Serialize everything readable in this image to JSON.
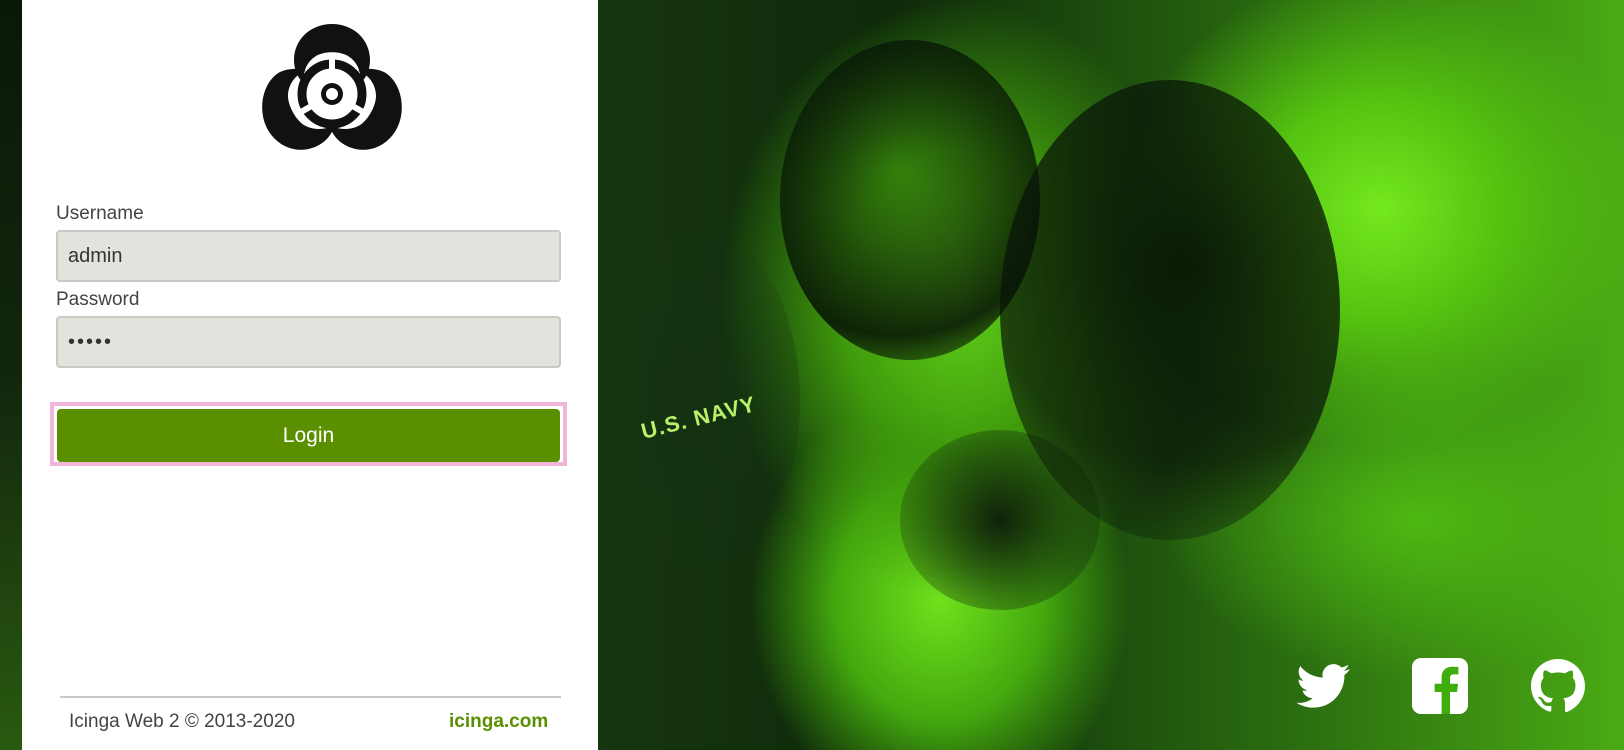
{
  "login_form": {
    "username_label": "Username",
    "username_value": "admin",
    "password_label": "Password",
    "password_value": "•••••",
    "login_button_label": "Login"
  },
  "footer": {
    "copyright": "Icinga Web 2 © 2013-2020",
    "link_text": "icinga.com"
  },
  "background": {
    "caption_text": "U.S. NAVY"
  },
  "icons": {
    "logo": "biohazard-icon",
    "social": [
      "twitter-icon",
      "facebook-icon",
      "github-icon"
    ]
  },
  "colors": {
    "accent": "#5a8f00",
    "focus_outline": "#f0b6d8",
    "input_bg": "#e1e4dd",
    "background_tint": "#62d41a"
  }
}
